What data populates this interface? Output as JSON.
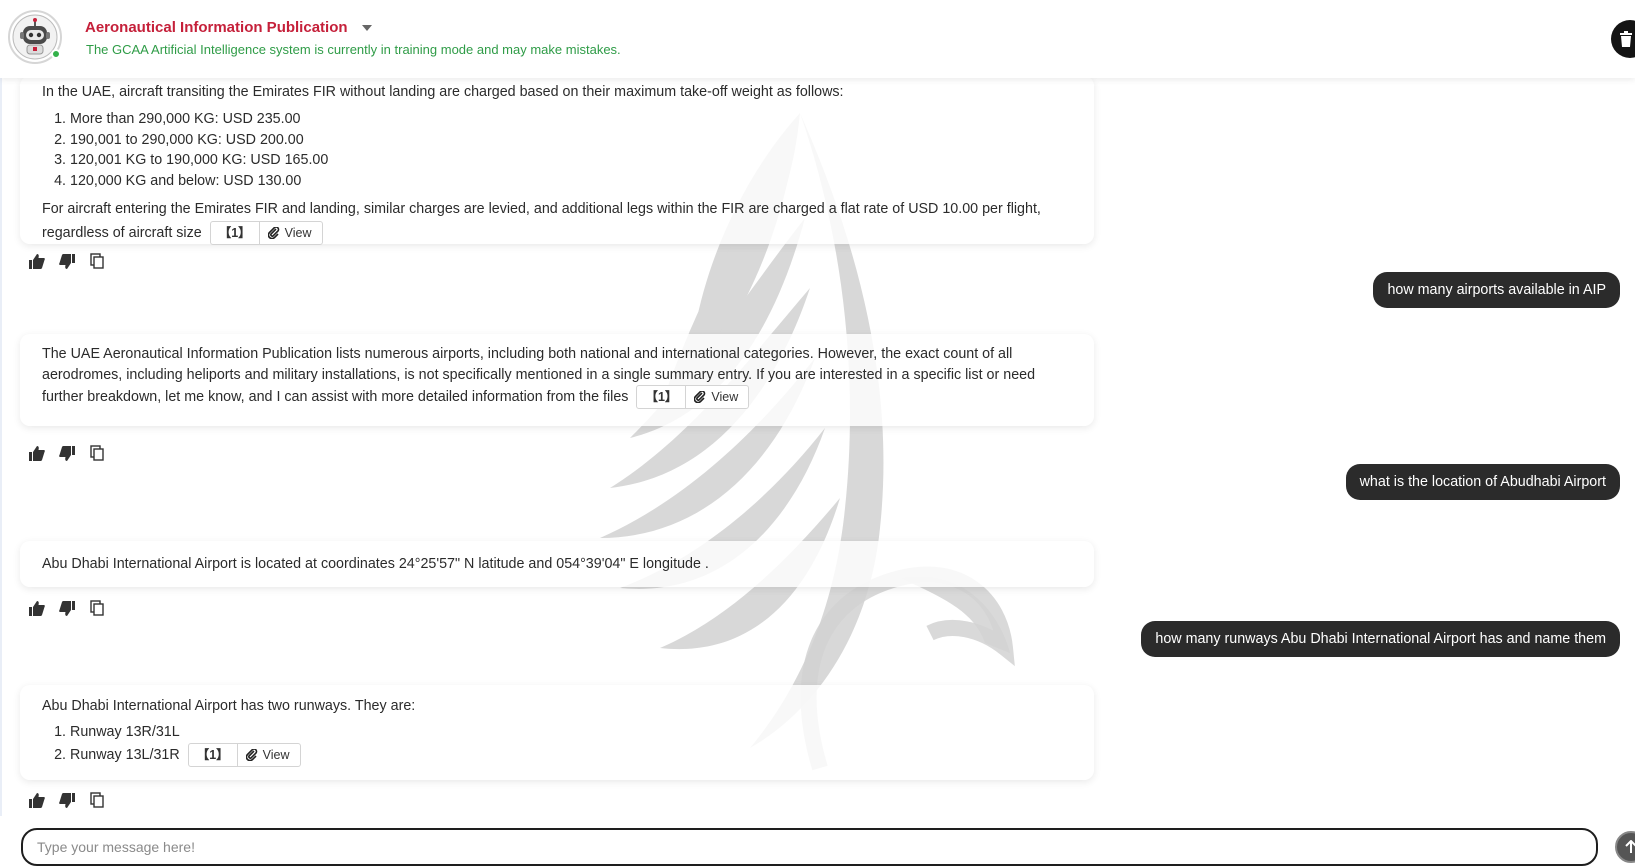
{
  "header": {
    "title": "Aeronautical Information Publication",
    "subtitle": "The GCAA Artificial Intelligence system is currently in training mode and may make mistakes."
  },
  "messages": {
    "m1": {
      "intro": "In the UAE, aircraft transiting the Emirates FIR without landing are charged based on their maximum take-off weight as follows:",
      "list": [
        "More than 290,000 KG: USD 235.00",
        "190,001 to 290,000 KG: USD 200.00",
        "120,001 KG to 190,000 KG: USD 165.00",
        "120,000 KG and below: USD 130.00"
      ],
      "outro": "For aircraft entering the Emirates FIR and landing, similar charges are levied, and additional legs within the FIR are charged a flat rate of USD 10.00 per flight, regardless of aircraft size",
      "cite_num": "【1】",
      "cite_view": "View"
    },
    "u1": "how many airports available in AIP",
    "m2": {
      "text": "The UAE Aeronautical Information Publication lists numerous airports, including both national and international categories. However, the exact count of all aerodromes, including heliports and military installations, is not specifically mentioned in a single summary entry. If you are interested in a specific list or need further breakdown, let me know, and I can assist with more detailed information from the files",
      "cite_num": "【1】",
      "cite_view": "View"
    },
    "u2": "what is the location of Abudhabi Airport",
    "m3": {
      "text": "Abu Dhabi International Airport is located at coordinates 24°25'57\" N latitude and 054°39'04\" E longitude ."
    },
    "u3": "how many runways Abu Dhabi International Airport has and name them",
    "m4": {
      "intro": "Abu Dhabi International Airport has two runways. They are:",
      "list": [
        "Runway 13R/31L",
        "Runway 13L/31R"
      ],
      "cite_num": "【1】",
      "cite_view": "View"
    }
  },
  "input": {
    "placeholder": "Type your message here!"
  },
  "icons": {
    "like": "thumbs-up-icon",
    "dislike": "thumbs-down-icon",
    "copy": "copy-icon",
    "cite": "paperclip-icon",
    "delete": "trash-icon",
    "send": "arrow-up-icon"
  },
  "colors": {
    "title": "#c5203a",
    "subtitle": "#2f9c47",
    "user_bubble": "#2b2b2b",
    "online": "#33b14a"
  }
}
